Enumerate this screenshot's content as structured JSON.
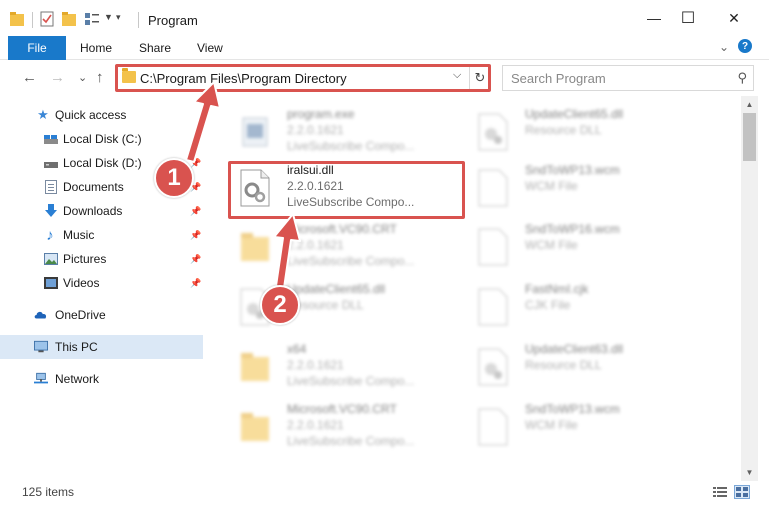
{
  "window": {
    "title": "Program",
    "minimize_glyph": "—",
    "maximize_glyph": "☐",
    "close_glyph": "✕"
  },
  "ribbon": {
    "tabs": [
      "File",
      "Home",
      "Share",
      "View"
    ],
    "expand_glyph": "⌄",
    "help_glyph": "?"
  },
  "nav": {
    "back_glyph": "←",
    "forward_glyph": "→",
    "recent_glyph": "⌄",
    "up_glyph": "↑",
    "address": "C:\\Program Files\\Program Directory",
    "dropdown_glyph": "⌵",
    "refresh_glyph": "↻",
    "search_placeholder": "Search Program",
    "search_glyph": "⚲"
  },
  "sidebar": {
    "items": [
      {
        "label": "Quick access",
        "icon": "star-icon"
      },
      {
        "label": "Local Disk (C:)",
        "icon": "drive-icon"
      },
      {
        "label": "Local Disk (D:)",
        "icon": "drive-icon"
      },
      {
        "label": "Documents",
        "icon": "documents-icon"
      },
      {
        "label": "Downloads",
        "icon": "downloads-icon"
      },
      {
        "label": "Music",
        "icon": "music-icon"
      },
      {
        "label": "Pictures",
        "icon": "pictures-icon"
      },
      {
        "label": "Videos",
        "icon": "videos-icon"
      },
      {
        "label": "OneDrive",
        "icon": "onedrive-icon"
      },
      {
        "label": "This PC",
        "icon": "pc-icon"
      },
      {
        "label": "Network",
        "icon": "network-icon"
      }
    ]
  },
  "files": [
    {
      "name": "program.exe",
      "line1": "2.2.0.1621",
      "line2": "LiveSubscribe Compo...",
      "type": "exe"
    },
    {
      "name": "UpdateClient65.dll",
      "line1": "Resource DLL",
      "line2": "",
      "type": "dll"
    },
    {
      "name": "iralsui.dll",
      "line1": "2.2.0.1621",
      "line2": "LiveSubscribe Compo...",
      "type": "dll"
    },
    {
      "name": "SndToWP13.wcm",
      "line1": "WCM File",
      "line2": "",
      "type": "blank"
    },
    {
      "name": "Microsoft.VC90.CRT",
      "line1": "2.2.0.1621",
      "line2": "LiveSubscribe Compo...",
      "type": "folder"
    },
    {
      "name": "SndToWP16.wcm",
      "line1": "WCM File",
      "line2": "",
      "type": "blank"
    },
    {
      "name": "UpdateClient65.dll",
      "line1": "Resource DLL",
      "line2": "",
      "type": "dll"
    },
    {
      "name": "FastNmI.cjk",
      "line1": "CJK File",
      "line2": "",
      "type": "blank"
    },
    {
      "name": "x64",
      "line1": "2.2.0.1621",
      "line2": "LiveSubscribe Compo...",
      "type": "folder"
    },
    {
      "name": "UpdateClient63.dll",
      "line1": "Resource DLL",
      "line2": "",
      "type": "dll"
    },
    {
      "name": "Microsoft.VC90.CRT",
      "line1": "2.2.0.1621",
      "line2": "LiveSubscribe Compo...",
      "type": "folder"
    },
    {
      "name": "SndToWP13.wcm",
      "line1": "WCM File",
      "line2": "",
      "type": "blank"
    }
  ],
  "status": {
    "item_count": "125 items"
  },
  "steps": [
    "1",
    "2"
  ],
  "colors": {
    "accent": "#1979ca",
    "highlight": "#d9534f",
    "folder": "#f3c24b"
  }
}
